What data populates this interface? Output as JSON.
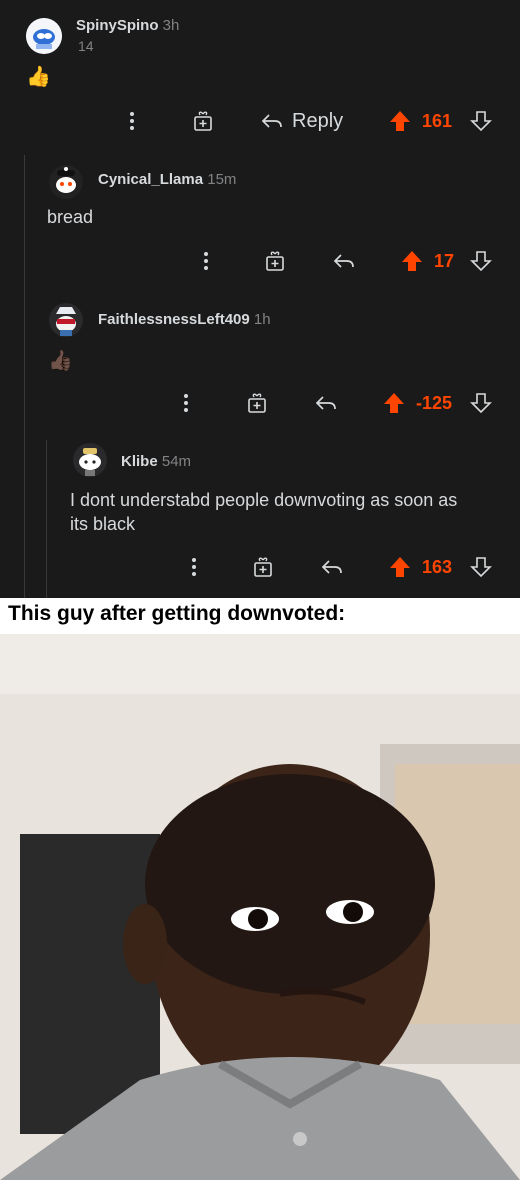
{
  "comments": [
    {
      "user": "SpinySpino",
      "age": "3h",
      "sub": "14",
      "body": "",
      "emoji": "👍",
      "score": "161",
      "reply_label": "Reply"
    },
    {
      "user": "Cynical_Llama",
      "age": "15m",
      "body": "bread",
      "score": "17"
    },
    {
      "user": "FaithlessnessLeft409",
      "age": "1h",
      "body": "",
      "emoji": "👍🏿",
      "score": "-125"
    },
    {
      "user": "Klibe",
      "age": "54m",
      "body_line1": "I dont understabd people downvoting as soon as",
      "body_line2": "its black",
      "score": "163"
    }
  ],
  "meme": {
    "caption": "This guy after getting downvoted:"
  },
  "colors": {
    "background": "#1a1a1b",
    "upvote": "#ff4500",
    "muted": "#818384",
    "text": "#d7dadc"
  },
  "icons": [
    "more-icon",
    "award-icon",
    "reply-icon",
    "upvote-icon",
    "downvote-icon"
  ]
}
